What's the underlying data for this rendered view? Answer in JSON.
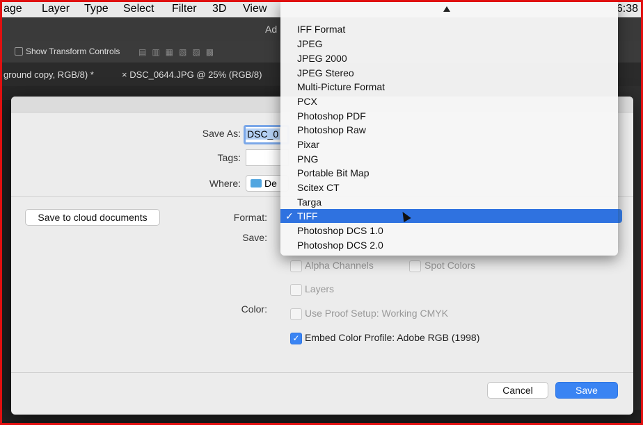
{
  "menubar": {
    "items": [
      "age",
      "Layer",
      "Type",
      "Select",
      "Filter",
      "3D",
      "View"
    ],
    "clock": "6:38"
  },
  "app": {
    "title_fragment": "Ad",
    "show_transform_controls": "Show Transform Controls",
    "tabs": [
      "ground copy, RGB/8) *",
      "× DSC_0644.JPG @ 25% (RGB/8)"
    ]
  },
  "dialog": {
    "save_as_label": "Save As:",
    "save_as_value": "DSC_0",
    "tags_label": "Tags:",
    "where_label": "Where:",
    "where_value": "De",
    "cloud_button": "Save to cloud documents",
    "format_label": "Format:",
    "save_label": "Save:",
    "color_label": "Color:",
    "options": {
      "alpha_channels": "Alpha Channels",
      "spot_colors": "Spot Colors",
      "layers": "Layers",
      "use_proof_setup": "Use Proof Setup:  Working CMYK",
      "embed_color_profile": "Embed Color Profile:  Adobe RGB (1998)"
    },
    "embed_checked": true,
    "cancel_button": "Cancel",
    "save_button": "Save"
  },
  "format_menu": {
    "items": [
      "IFF Format",
      "JPEG",
      "JPEG 2000",
      "JPEG Stereo",
      "Multi-Picture Format",
      "PCX",
      "Photoshop PDF",
      "Photoshop Raw",
      "Pixar",
      "PNG",
      "Portable Bit Map",
      "Scitex CT",
      "Targa",
      "TIFF",
      "Photoshop DCS 1.0",
      "Photoshop DCS 2.0"
    ],
    "selected": "TIFF",
    "checkmark": "✓"
  },
  "colors": {
    "accent": "#2f72e0",
    "frame": "#e01010"
  }
}
